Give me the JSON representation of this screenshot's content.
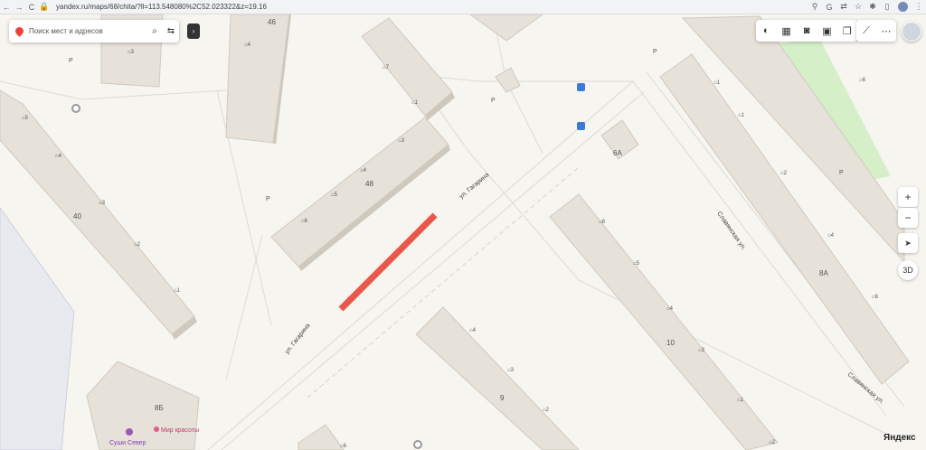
{
  "browser": {
    "back": "←",
    "forward": "→",
    "reload": "C",
    "url": "yandex.ru/maps/68/chita/?ll=113.548080%2C52.023322&z=19.16",
    "icons": [
      "location-icon",
      "google-icon",
      "translate-icon",
      "star-icon",
      "extension-icon"
    ]
  },
  "search": {
    "placeholder": "Поиск мест и адресов",
    "icon": "search-icon",
    "route_icon": "route-icon"
  },
  "collapse": "›",
  "map": {
    "streets": [
      {
        "id": "gagarina1",
        "name": "ул. Гагарина"
      },
      {
        "id": "gagarina2",
        "name": "ул. Гагарина"
      },
      {
        "id": "slav1",
        "name": "Славянская ул."
      },
      {
        "id": "slav2",
        "name": "Славянская ул."
      }
    ],
    "building_labels": [
      "46",
      "48",
      "40",
      "10",
      "9",
      "6А",
      "8Б",
      "8А"
    ],
    "entrances": [
      "3",
      "4",
      "7",
      "1",
      "5",
      "4",
      "3",
      "2",
      "1",
      "3",
      "4",
      "5",
      "6",
      "1",
      "2",
      "3",
      "4",
      "5",
      "6",
      "7",
      "1",
      "2",
      "3",
      "4",
      "5",
      "6",
      "1",
      "2",
      "3",
      "4",
      "5",
      "6",
      "1",
      "2",
      "3",
      "4",
      "5",
      "6",
      "1",
      "2",
      "3",
      "1",
      "4"
    ],
    "parking": [
      "P",
      "P",
      "P",
      "P",
      "P"
    ],
    "pois": [
      {
        "name": "Суши Север"
      },
      {
        "name": "Мир красоты"
      }
    ],
    "highlight_color": "#e9584b"
  },
  "toolbar_right": {
    "groups": [
      [
        "layers-icon",
        "panorama-icon",
        "camera-icon",
        "bus-icon",
        "layers-stack-icon"
      ],
      [
        "ruler-icon",
        "more-icon"
      ]
    ]
  },
  "controls": {
    "zoom_in": "+",
    "zoom_out": "−",
    "locate": "➤",
    "view3d": "3D"
  },
  "brand": "Яндекс"
}
